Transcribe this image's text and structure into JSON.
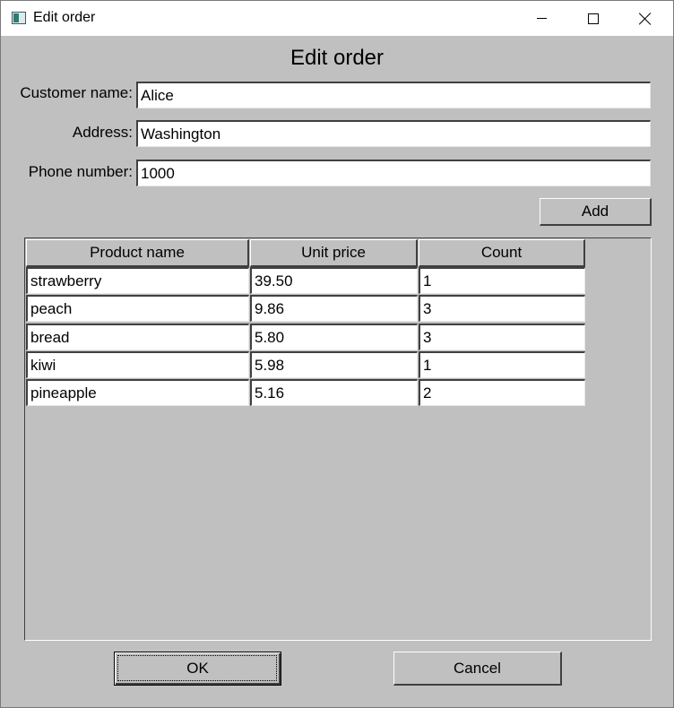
{
  "window": {
    "title": "Edit order",
    "min_icon": "minimize-icon",
    "max_icon": "maximize-icon",
    "close_icon": "close-icon"
  },
  "heading": "Edit order",
  "form": {
    "customer_label": "Customer name:",
    "customer_value": "Alice",
    "address_label": "Address:",
    "address_value": "Washington",
    "phone_label": "Phone number:",
    "phone_value": "1000"
  },
  "add_label": "Add",
  "table": {
    "columns": [
      "Product name",
      "Unit price",
      "Count"
    ],
    "rows": [
      [
        "strawberry",
        "39.50",
        "1"
      ],
      [
        "peach",
        "9.86",
        "3"
      ],
      [
        "bread",
        "5.80",
        "3"
      ],
      [
        "kiwi",
        "5.98",
        "1"
      ],
      [
        "pineapple",
        "5.16",
        "2"
      ]
    ]
  },
  "ok_label": "OK",
  "cancel_label": "Cancel"
}
